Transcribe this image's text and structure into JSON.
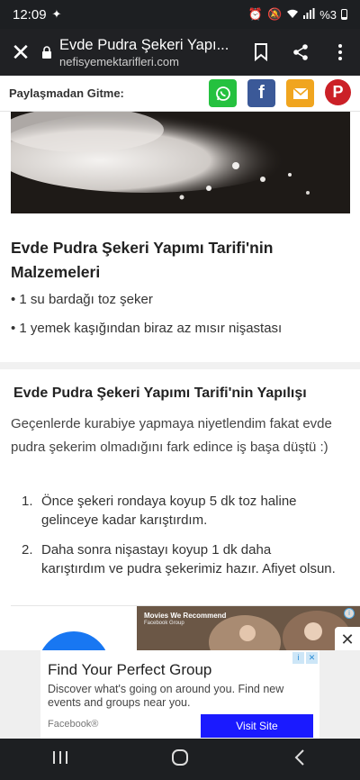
{
  "status_bar": {
    "time": "12:09",
    "battery": "%3"
  },
  "browser": {
    "page_title": "Evde Pudra Şekeri Yapı...",
    "domain": "nefisyemektarifleri.com"
  },
  "share_bar": {
    "label": "Paylaşmadan Gitme:",
    "buttons": [
      {
        "name": "whatsapp",
        "color": "#25c13f"
      },
      {
        "name": "facebook",
        "glyph": "f",
        "color": "#3b5998"
      },
      {
        "name": "email",
        "color": "#f0a51f"
      },
      {
        "name": "pinterest",
        "glyph": "P",
        "color": "#cb2027"
      }
    ]
  },
  "ingredients": {
    "title": "Evde Pudra Şekeri Yapımı Tarifi'nin Malzemeleri",
    "items": [
      "1 su bardağı toz şeker",
      "1 yemek kaşığından biraz az mısır nişastası"
    ]
  },
  "method": {
    "title": "Evde Pudra Şekeri Yapımı Tarifi'nin Yapılışı",
    "intro": "Geçenlerde kurabiye yapmaya niyetlendim fakat evde pudra şekerim olmadığını fark edince iş başa düştü :)",
    "steps": [
      {
        "num": "1.",
        "text": "Önce şekeri rondaya koyup 5 dk toz haline gelinceye kadar karıştırdım."
      },
      {
        "num": "2.",
        "text": "Daha sonra nişastayı koyup 1 dk daha karıştırdım ve pudra şekerimiz hazır. Afiyet olsun."
      }
    ]
  },
  "inline_ad": {
    "caption": "Movies We Recommend",
    "subcaption": "Facebook Group"
  },
  "banner_ad": {
    "title": "Find Your Perfect Group",
    "description": "Discover what's going on around you. Find new events and groups near you.",
    "brand": "Facebook®",
    "cta": "Visit Site"
  },
  "colors": {
    "status_bar_bg": "#1d1f22",
    "url_bar_bg": "#202124",
    "cta_blue": "#1a1aff",
    "facebook_blue": "#1877f2"
  }
}
